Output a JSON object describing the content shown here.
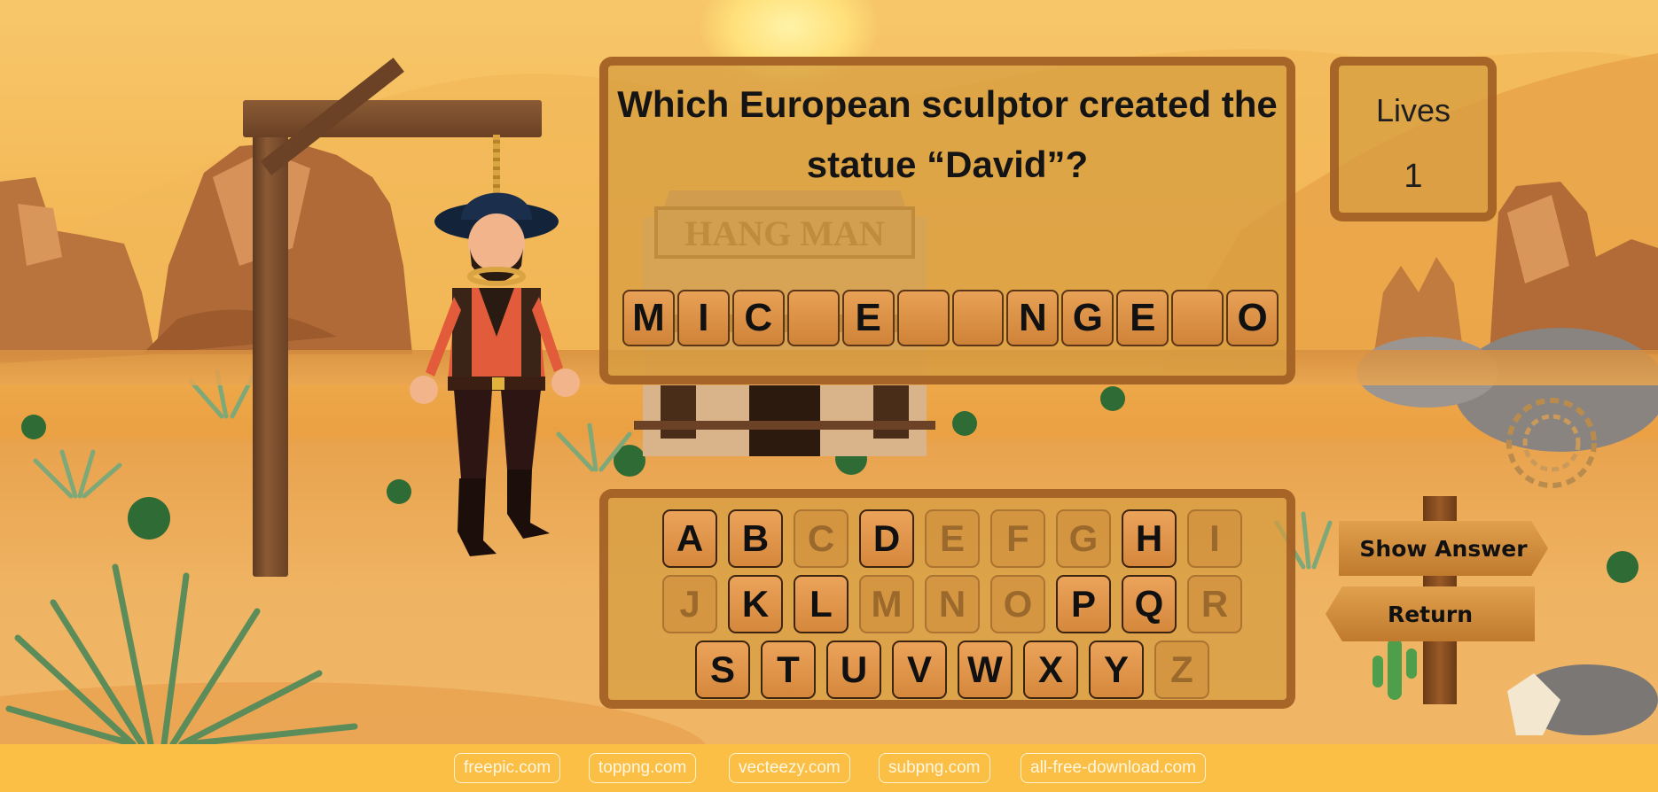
{
  "question": {
    "text": "Which European sculptor created the statue “David”?"
  },
  "answer_slots": [
    "M",
    "I",
    "C",
    "",
    "E",
    "",
    "",
    "N",
    "G",
    "E",
    "",
    "O"
  ],
  "lives": {
    "label": "Lives",
    "value": "1"
  },
  "keyboard": {
    "rows": [
      [
        {
          "letter": "A",
          "used": false
        },
        {
          "letter": "B",
          "used": false
        },
        {
          "letter": "C",
          "used": true
        },
        {
          "letter": "D",
          "used": false
        },
        {
          "letter": "E",
          "used": true
        },
        {
          "letter": "F",
          "used": true
        },
        {
          "letter": "G",
          "used": true
        },
        {
          "letter": "H",
          "used": false
        },
        {
          "letter": "I",
          "used": true
        }
      ],
      [
        {
          "letter": "J",
          "used": true
        },
        {
          "letter": "K",
          "used": false
        },
        {
          "letter": "L",
          "used": false
        },
        {
          "letter": "M",
          "used": true
        },
        {
          "letter": "N",
          "used": true
        },
        {
          "letter": "O",
          "used": true
        },
        {
          "letter": "P",
          "used": false
        },
        {
          "letter": "Q",
          "used": false
        },
        {
          "letter": "R",
          "used": true
        }
      ],
      [
        {
          "letter": "S",
          "used": false
        },
        {
          "letter": "T",
          "used": false
        },
        {
          "letter": "U",
          "used": false
        },
        {
          "letter": "V",
          "used": false
        },
        {
          "letter": "W",
          "used": false
        },
        {
          "letter": "X",
          "used": false
        },
        {
          "letter": "Y",
          "used": false
        },
        {
          "letter": "Z",
          "used": true
        }
      ]
    ]
  },
  "signs": {
    "show_answer": "Show Answer",
    "return": "Return"
  },
  "credits": [
    "freepic.com",
    "toppng.com",
    "vecteezy.com",
    "subpng.com",
    "all-free-download.com"
  ]
}
